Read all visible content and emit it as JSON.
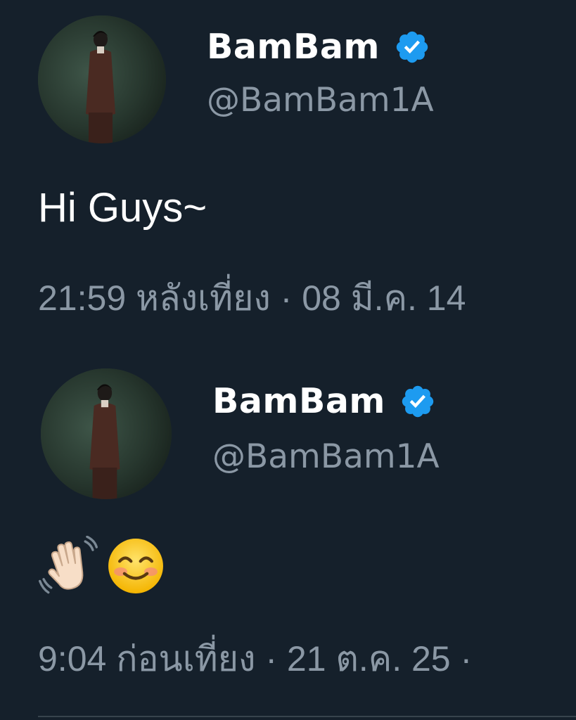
{
  "tweets": [
    {
      "display_name": "BamBam",
      "handle": "@BamBam1A",
      "verified": true,
      "text": "Hi Guys~",
      "timestamp": "21:59 หลังเที่ยง · 08 มี.ค. 14"
    },
    {
      "display_name": "BamBam",
      "handle": "@BamBam1A",
      "verified": true,
      "emojis": [
        "waving-hand-emoji",
        "smiling-face-emoji"
      ],
      "timestamp": "9:04 ก่อนเที่ยง · 21 ต.ค. 25 ·"
    }
  ],
  "colors": {
    "background": "#15202b",
    "name_text": "#ffffff",
    "secondary_text": "#8b98a5",
    "verified_badge": "#1d9bf0"
  },
  "icons": {
    "verified": "verified-badge-icon",
    "avatar": "profile-photo"
  }
}
